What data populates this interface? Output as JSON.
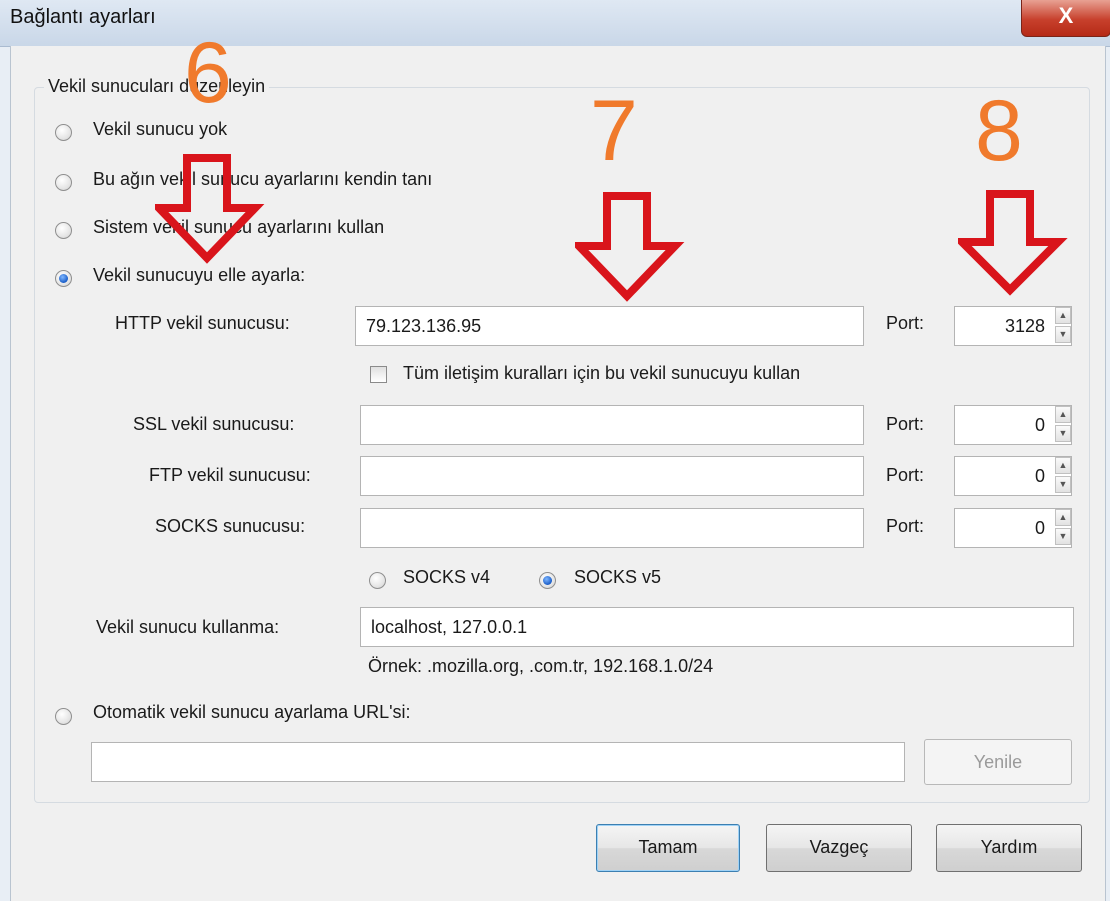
{
  "window": {
    "title": "Bağlantı ayarları",
    "close_glyph": "X"
  },
  "group_title": "Vekil sunucuları düzenleyin",
  "proxy_modes": [
    {
      "label": "Vekil sunucu yok",
      "selected": false
    },
    {
      "label": "Bu ağın vekil sunucu ayarlarını kendin tanı",
      "selected": false
    },
    {
      "label": "Sistem vekil sunucu ayarlarını kullan",
      "selected": false
    },
    {
      "label": "Vekil sunucuyu elle ayarla:",
      "selected": true
    },
    {
      "label": "Otomatik vekil sunucu ayarlama URL'si:",
      "selected": false
    }
  ],
  "manual": {
    "port_label": "Port:",
    "http": {
      "label": "HTTP vekil sunucusu:",
      "value": "79.123.136.95",
      "port": "3128"
    },
    "share_all_label": "Tüm iletişim kuralları için bu vekil sunucuyu kullan",
    "share_all_checked": false,
    "ssl": {
      "label": "SSL vekil sunucusu:",
      "value": "",
      "port": "0"
    },
    "ftp": {
      "label": "FTP vekil sunucusu:",
      "value": "",
      "port": "0"
    },
    "socks": {
      "label": "SOCKS sunucusu:",
      "value": "",
      "port": "0"
    },
    "socks_versions": [
      {
        "label": "SOCKS v4",
        "selected": false
      },
      {
        "label": "SOCKS v5",
        "selected": true
      }
    ],
    "no_proxy": {
      "label": "Vekil sunucu kullanma:",
      "value": "localhost, 127.0.0.1"
    },
    "example": "Örnek: .mozilla.org, .com.tr, 192.168.1.0/24"
  },
  "auto_url": {
    "value": "",
    "reload_label": "Yenile"
  },
  "buttons": {
    "ok": "Tamam",
    "cancel": "Vazgeç",
    "help": "Yardım"
  },
  "annotations": {
    "n6": "6",
    "n7": "7",
    "n8": "8"
  },
  "colors": {
    "annotation_number": "#f07a2c",
    "annotation_arrow": "#d9141b",
    "selected_radio": "#1a5dc8"
  },
  "icons": {
    "spin_up": "▲",
    "spin_down": "▼"
  }
}
